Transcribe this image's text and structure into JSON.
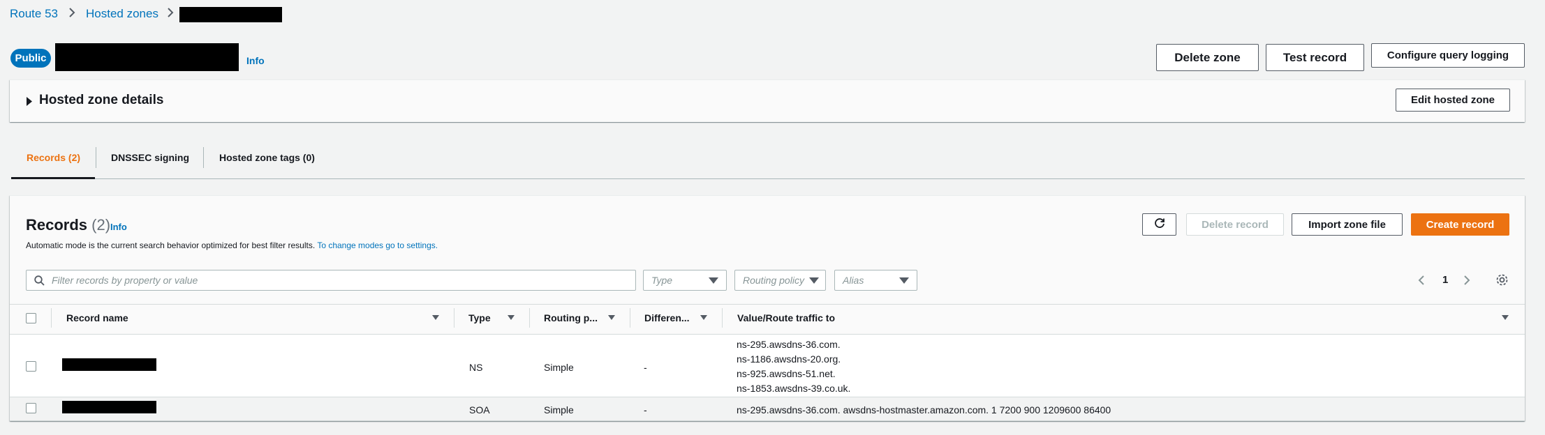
{
  "breadcrumb": {
    "items": [
      "Route 53",
      "Hosted zones"
    ],
    "separator": ">"
  },
  "zone_header": {
    "badge": "Public",
    "info": "Info",
    "buttons": {
      "delete_zone": "Delete zone",
      "test_record": "Test record",
      "configure_query_logging": "Configure query logging"
    }
  },
  "details_panel": {
    "title": "Hosted zone details",
    "edit_button": "Edit hosted zone"
  },
  "tabs": [
    {
      "label": "Records (2)",
      "active": true
    },
    {
      "label": "DNSSEC signing",
      "active": false
    },
    {
      "label": "Hosted zone tags (0)",
      "active": false
    }
  ],
  "records_panel": {
    "title": "Records",
    "count": "(2)",
    "info": "Info",
    "description": "Automatic mode is the current search behavior optimized for best filter results.",
    "settings_link": "To change modes go to settings.",
    "buttons": {
      "refresh_icon": "refresh-icon",
      "delete_record": "Delete record",
      "import_zone_file": "Import zone file",
      "create_record": "Create record"
    },
    "filter": {
      "placeholder": "Filter records by property or value",
      "type_placeholder": "Type",
      "routing_placeholder": "Routing policy",
      "alias_placeholder": "Alias"
    },
    "pagination": {
      "page": "1"
    },
    "columns": [
      "Record name",
      "Type",
      "Routing p...",
      "Differen...",
      "Value/Route traffic to"
    ],
    "rows": [
      {
        "type": "NS",
        "routing": "Simple",
        "differentiator": "-",
        "values": [
          "ns-295.awsdns-36.com.",
          "ns-1186.awsdns-20.org.",
          "ns-925.awsdns-51.net.",
          "ns-1853.awsdns-39.co.uk."
        ]
      },
      {
        "type": "SOA",
        "routing": "Simple",
        "differentiator": "-",
        "values": [
          "ns-295.awsdns-36.com. awsdns-hostmaster.amazon.com. 1 7200 900 1209600 86400"
        ]
      }
    ]
  },
  "colors": {
    "link": "#0073bb",
    "accent": "#ec7211",
    "background": "#f2f3f3"
  }
}
